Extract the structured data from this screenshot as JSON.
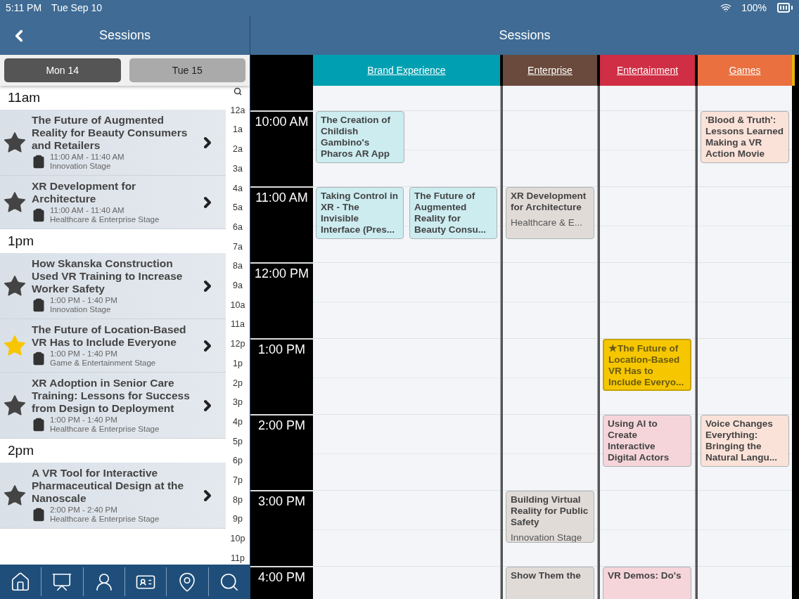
{
  "status_bar": {
    "time": "5:11 PM",
    "date": "Tue Sep 10",
    "battery": "100%"
  },
  "left_header": {
    "title": "Sessions"
  },
  "day_tabs": [
    {
      "label": "Mon 14",
      "selected": true
    },
    {
      "label": "Tue 15",
      "selected": false
    }
  ],
  "sections": [
    {
      "heading": "11am",
      "sessions": [
        {
          "title": "The Future of Augmented Reality for Beauty Consumers and Retailers",
          "time": "11:00 AM - 11:40 AM",
          "stage": "Innovation Stage",
          "starred": false
        },
        {
          "title": "XR Development for Architecture",
          "time": "11:00 AM - 11:40 AM",
          "stage": "Healthcare & Enterprise Stage",
          "starred": false
        }
      ]
    },
    {
      "heading": "1pm",
      "sessions": [
        {
          "title": "How Skanska Construction Used VR Training to Increase Worker Safety",
          "time": "1:00 PM - 1:40 PM",
          "stage": "Innovation Stage",
          "starred": false
        },
        {
          "title": "The Future of Location-Based VR Has to Include Everyone",
          "time": "1:00 PM - 1:40 PM",
          "stage": "Game & Entertainment Stage",
          "starred": true
        },
        {
          "title": "XR Adoption in Senior Care Training: Lessons for Success from Design to Deployment",
          "time": "1:00 PM - 1:40 PM",
          "stage": "Healthcare & Enterprise Stage",
          "starred": false
        }
      ]
    },
    {
      "heading": "2pm",
      "sessions": [
        {
          "title": "A VR Tool for Interactive Pharmaceutical Design at the Nanoscale",
          "time": "2:00 PM - 2:40 PM",
          "stage": "Healthcare & Enterprise Stage",
          "starred": false
        }
      ]
    }
  ],
  "hour_index": [
    "12a",
    "1a",
    "2a",
    "3a",
    "4a",
    "5a",
    "6a",
    "7a",
    "8a",
    "9a",
    "10a",
    "11a",
    "12p",
    "1p",
    "2p",
    "3p",
    "4p",
    "5p",
    "6p",
    "7p",
    "8p",
    "9p",
    "10p",
    "11p"
  ],
  "bottom_tabs": [
    {
      "kind": "home"
    },
    {
      "kind": "presentation"
    },
    {
      "kind": "speaker"
    },
    {
      "kind": "badge"
    },
    {
      "kind": "map"
    },
    {
      "kind": "search"
    }
  ],
  "right_header": {
    "title": "Sessions"
  },
  "tracks": [
    {
      "label": "Brand Experience",
      "color": "#00a0b2"
    },
    {
      "label": "Enterprise",
      "color": "#6a4a3c"
    },
    {
      "label": "Entertainment",
      "color": "#cf2e44"
    },
    {
      "label": "Games",
      "color": "#ea7040"
    }
  ],
  "hours": [
    {
      "time": "10:00 AM",
      "cells": [
        [
          {
            "title": "The Creation of Childish Gambino's Pharos AR App",
            "starred": false
          }
        ],
        [],
        [],
        [
          {
            "title": "'Blood & Truth': Lessons Learned Making a VR Action Movie",
            "starred": false
          }
        ]
      ]
    },
    {
      "time": "11:00 AM",
      "cells": [
        [
          {
            "title": "Taking Control in XR - The Invisible Interface (Pres...",
            "starred": false
          },
          {
            "title": "The Future of Augmented Reality for Beauty Consu...",
            "starred": false
          }
        ],
        [
          {
            "title": "XR Development for Architecture",
            "stage": "Healthcare & E...",
            "starred": false
          }
        ],
        [],
        []
      ]
    },
    {
      "time": "12:00 PM",
      "cells": [
        [],
        [],
        [],
        []
      ]
    },
    {
      "time": "1:00 PM",
      "cells": [
        [],
        [],
        [
          {
            "title": "★The Future of Location-Based VR Has to Include Everyo...",
            "starred": true
          }
        ],
        []
      ]
    },
    {
      "time": "2:00 PM",
      "cells": [
        [],
        [],
        [
          {
            "title": "Using AI to Create Interactive Digital Actors",
            "starred": false
          }
        ],
        [
          {
            "title": "Voice Changes Everything: Bringing the Natural Langu...",
            "starred": false
          }
        ]
      ]
    },
    {
      "time": "3:00 PM",
      "cells": [
        [],
        [
          {
            "title": "Building Virtual Reality for Public Safety",
            "stage": "Innovation Stage",
            "starred": false
          }
        ],
        [],
        []
      ]
    },
    {
      "time": "4:00 PM",
      "cells": [
        [],
        [
          {
            "title": "Show Them the",
            "starred": false
          }
        ],
        [
          {
            "title": "VR Demos: Do's",
            "starred": false
          }
        ],
        []
      ]
    }
  ]
}
